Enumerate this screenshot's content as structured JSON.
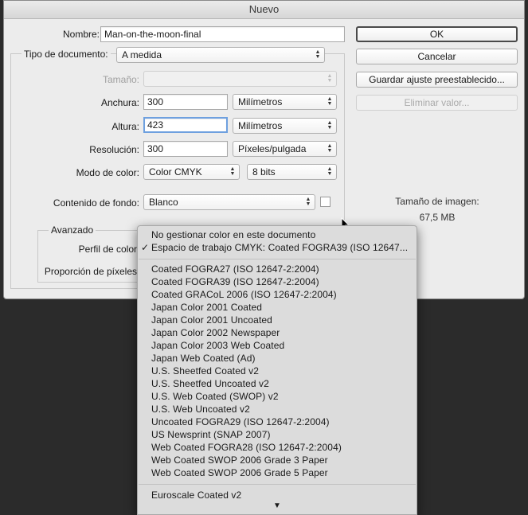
{
  "window": {
    "title": "Nuevo"
  },
  "form": {
    "nombre_label": "Nombre:",
    "nombre_value": "Man-on-the-moon-final",
    "tipo_label": "Tipo de documento:",
    "tipo_value": "A medida",
    "tamano_label": "Tamaño:",
    "tamano_value": "",
    "anchura_label": "Anchura:",
    "anchura_value": "300",
    "anchura_unit": "Milímetros",
    "altura_label": "Altura:",
    "altura_value": "423",
    "altura_unit": "Milímetros",
    "resolucion_label": "Resolución:",
    "resolucion_value": "300",
    "resolucion_unit": "Píxeles/pulgada",
    "modo_label": "Modo de color:",
    "modo_value": "Color CMYK",
    "bits_value": "8 bits",
    "fondo_label": "Contenido de fondo:",
    "fondo_value": "Blanco",
    "avanzado_label": "Avanzado",
    "perfil_label": "Perfil de color",
    "proporcion_label": "Proporción de píxeles"
  },
  "buttons": {
    "ok": "OK",
    "cancel": "Cancelar",
    "save_preset": "Guardar ajuste preestablecido...",
    "delete_value": "Eliminar valor..."
  },
  "image_size": {
    "label": "Tamaño de imagen:",
    "value": "67,5 MB"
  },
  "popup": {
    "checked_mark": "✓",
    "scroll_down": "▼",
    "group1": [
      "No gestionar color en este documento",
      "Espacio de trabajo CMYK: Coated FOGRA39 (ISO 12647..."
    ],
    "group2": [
      "Coated FOGRA27 (ISO 12647-2:2004)",
      "Coated FOGRA39 (ISO 12647-2:2004)",
      "Coated GRACoL 2006 (ISO 12647-2:2004)",
      "Japan Color 2001 Coated",
      "Japan Color 2001 Uncoated",
      "Japan Color 2002 Newspaper",
      "Japan Color 2003 Web Coated",
      "Japan Web Coated (Ad)",
      "U.S. Sheetfed Coated v2",
      "U.S. Sheetfed Uncoated v2",
      "U.S. Web Coated (SWOP) v2",
      "U.S. Web Uncoated v2",
      "Uncoated FOGRA29 (ISO 12647-2:2004)",
      "US Newsprint (SNAP 2007)",
      "Web Coated FOGRA28 (ISO 12647-2:2004)",
      "Web Coated SWOP 2006 Grade 3 Paper",
      "Web Coated SWOP 2006 Grade 5 Paper"
    ],
    "group3": [
      "Euroscale Coated v2"
    ]
  }
}
